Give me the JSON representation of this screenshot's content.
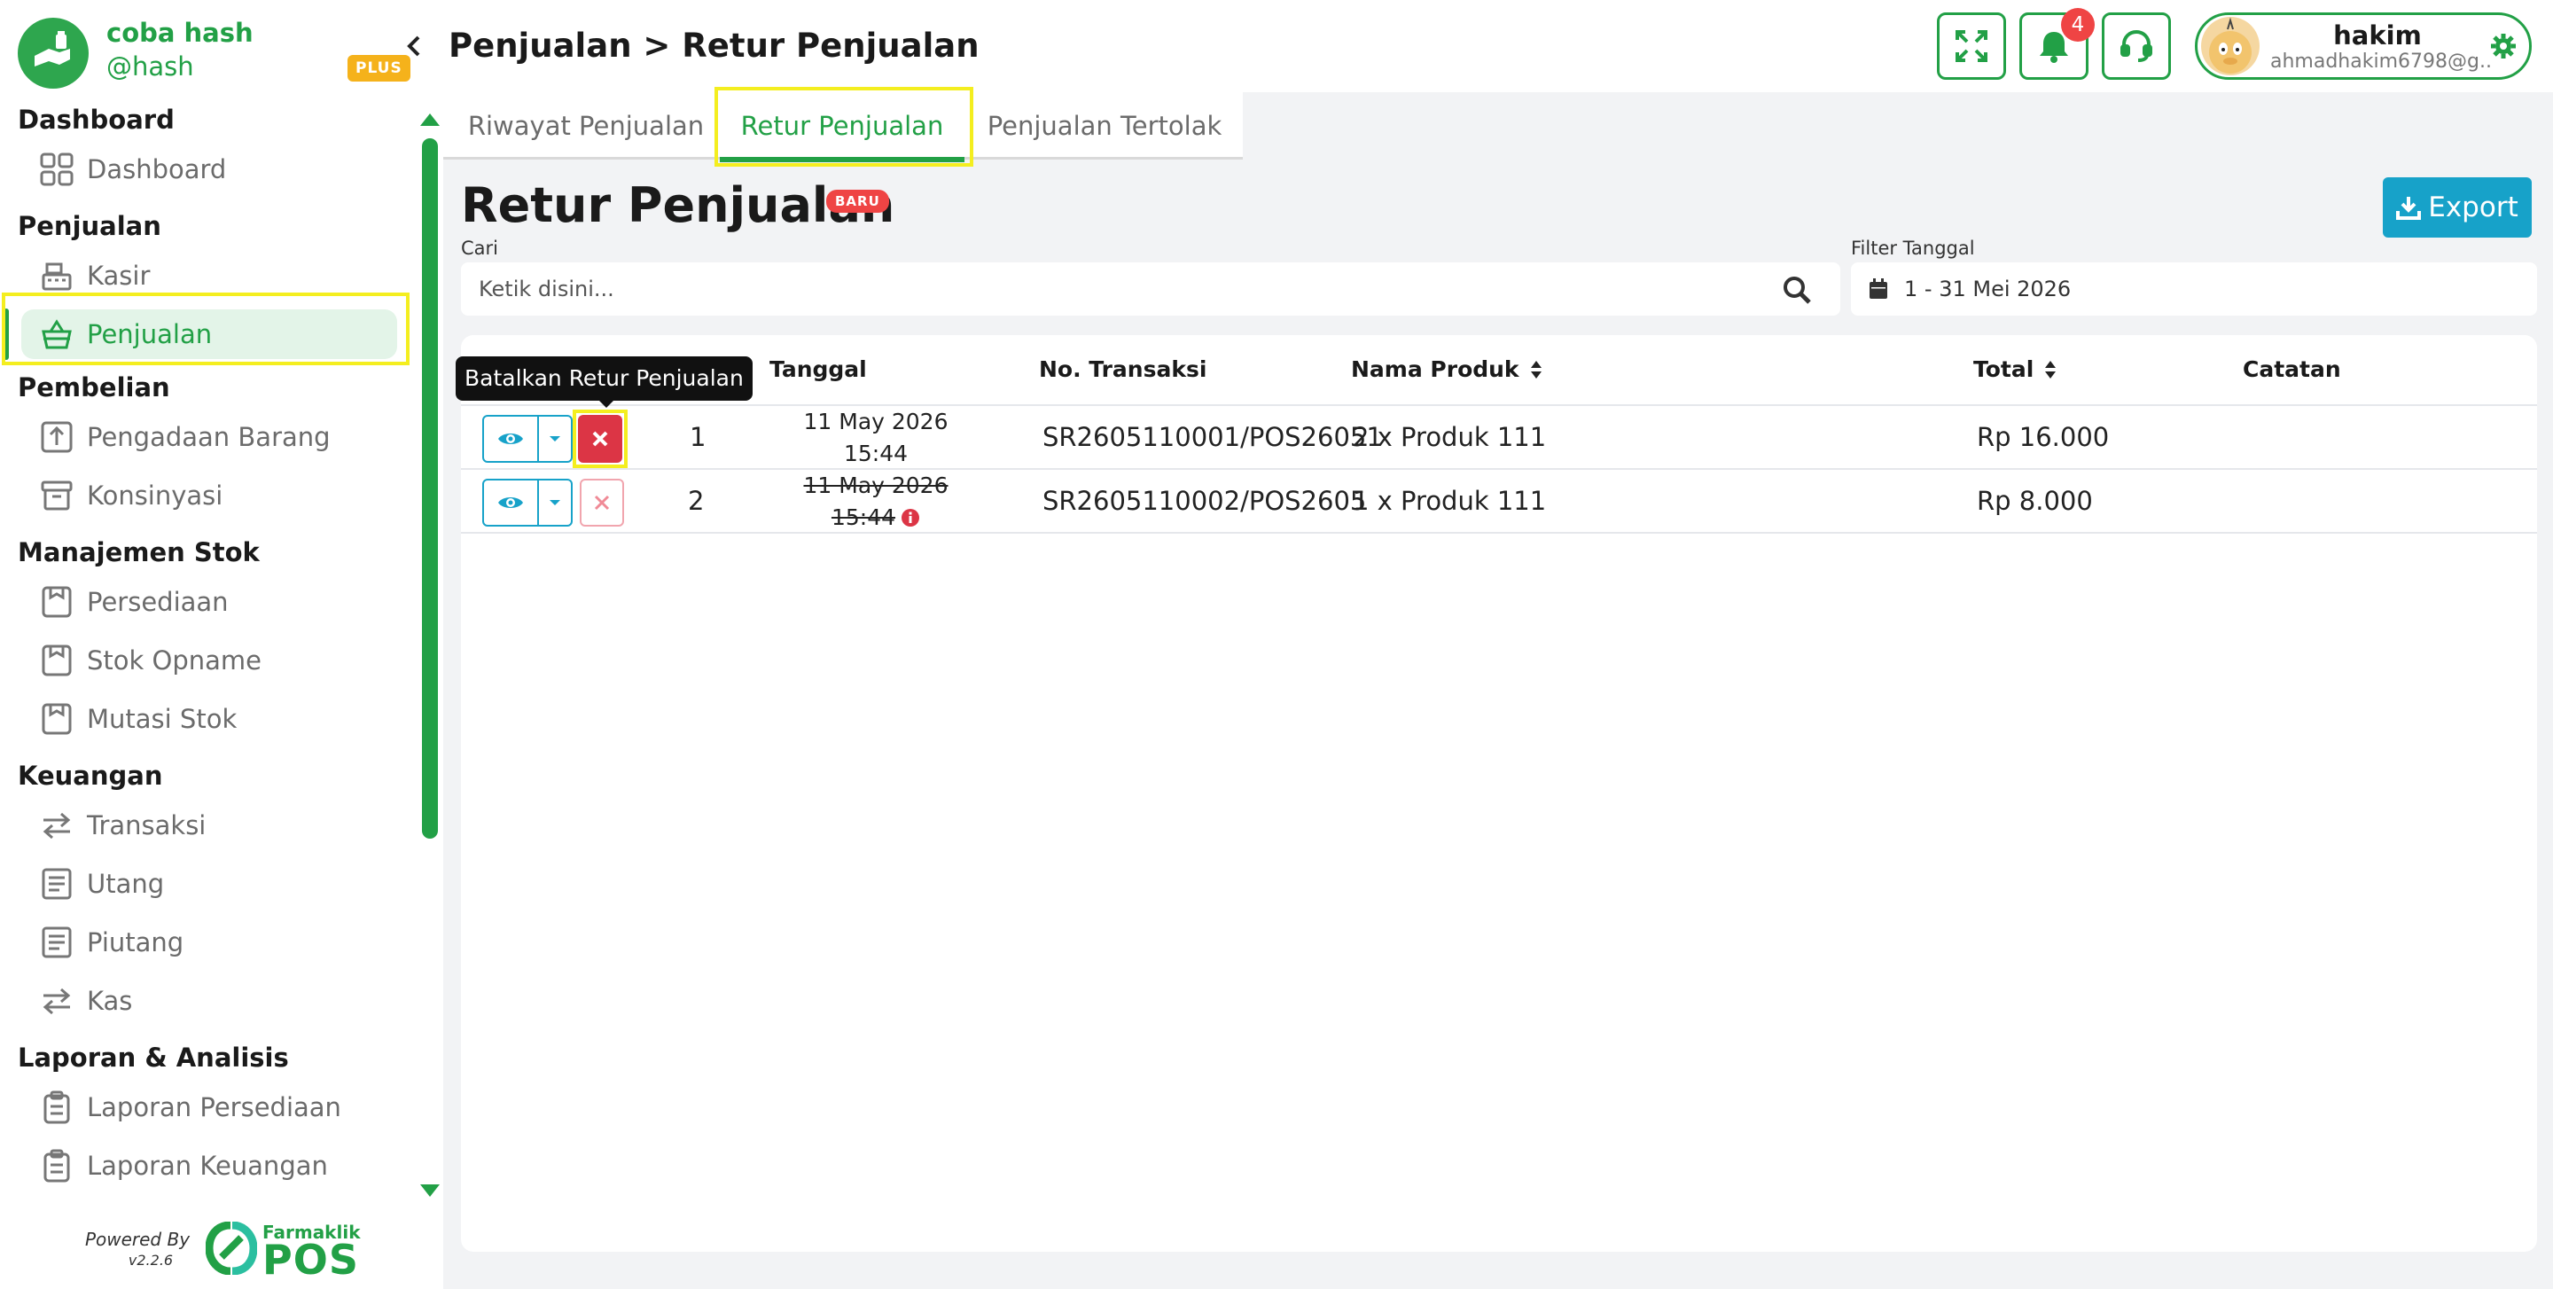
{
  "brand": {
    "name": "coba hash",
    "handle": "@hash",
    "plan_badge": "PLUS"
  },
  "sidebar": {
    "sections": [
      {
        "title": "Dashboard",
        "items": [
          {
            "label": "Dashboard",
            "icon": "grid-icon"
          }
        ]
      },
      {
        "title": "Penjualan",
        "items": [
          {
            "label": "Kasir",
            "icon": "cash-register-icon"
          },
          {
            "label": "Penjualan",
            "icon": "basket-icon",
            "active": true
          }
        ]
      },
      {
        "title": "Pembelian",
        "items": [
          {
            "label": "Pengadaan Barang",
            "icon": "upload-box-icon"
          },
          {
            "label": "Konsinyasi",
            "icon": "archive-box-icon"
          }
        ]
      },
      {
        "title": "Manajemen Stok",
        "items": [
          {
            "label": "Persediaan",
            "icon": "box-icon"
          },
          {
            "label": "Stok Opname",
            "icon": "box-icon"
          },
          {
            "label": "Mutasi Stok",
            "icon": "box-icon"
          }
        ]
      },
      {
        "title": "Keuangan",
        "items": [
          {
            "label": "Transaksi",
            "icon": "exchange-icon"
          },
          {
            "label": "Utang",
            "icon": "receipt-icon"
          },
          {
            "label": "Piutang",
            "icon": "receipt-icon"
          },
          {
            "label": "Kas",
            "icon": "exchange-icon"
          }
        ]
      },
      {
        "title": "Laporan & Analisis",
        "items": [
          {
            "label": "Laporan Persediaan",
            "icon": "clipboard-icon"
          },
          {
            "label": "Laporan Keuangan",
            "icon": "clipboard-icon"
          }
        ]
      }
    ],
    "powered_by": "Powered By",
    "version": "v2.2.6",
    "footer_logo_small": "Farmaklik",
    "footer_logo_big": "POS"
  },
  "header": {
    "title": "Penjualan > Retur Penjualan",
    "notification_count": "4",
    "user": {
      "name": "hakim",
      "email": "ahmadhakim6798@g..."
    }
  },
  "tabs": [
    {
      "label": "Riwayat Penjualan"
    },
    {
      "label": "Retur Penjualan",
      "active": true
    },
    {
      "label": "Penjualan Tertolak"
    }
  ],
  "page": {
    "title": "Retur Penjualan",
    "badge": "BARU",
    "export_label": "Export",
    "search_label": "Cari",
    "search_placeholder": "Ketik disini...",
    "date_filter_label": "Filter Tanggal",
    "date_filter_value": "1 - 31 Mei 2026"
  },
  "table": {
    "headers": {
      "tanggal": "Tanggal",
      "no_transaksi": "No. Transaksi",
      "nama_produk": "Nama Produk",
      "total": "Total",
      "catatan": "Catatan"
    },
    "rows": [
      {
        "no": "1",
        "date": "11 May 2026",
        "time": "15:44",
        "no_transaksi": "SR2605110001/POS26051",
        "produk": "2 x Produk 111",
        "total": "Rp 16.000",
        "catatan": "",
        "cancelled": false
      },
      {
        "no": "2",
        "date": "11 May 2026",
        "time": "15:44",
        "no_transaksi": "SR2605110002/POS2605",
        "produk": "1 x Produk 111",
        "total": "Rp 8.000",
        "catatan": "",
        "cancelled": true
      }
    ]
  },
  "tooltip": "Batalkan Retur Penjualan",
  "colors": {
    "primary": "#22a046",
    "accent": "#17a2c9",
    "danger": "#dc3545",
    "highlight": "#f4ee1f"
  }
}
